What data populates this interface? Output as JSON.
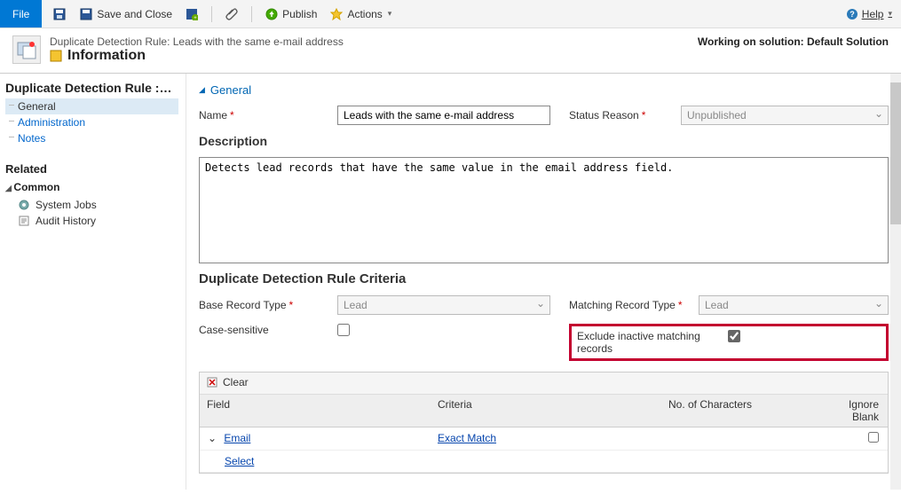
{
  "ribbon": {
    "file": "File",
    "save_close": "Save and Close",
    "publish": "Publish",
    "actions": "Actions",
    "help": "Help"
  },
  "header": {
    "entity": "Duplicate Detection Rule: Leads with the same e-mail address",
    "title": "Information",
    "solution_label": "Working on solution: Default Solution"
  },
  "sidebar": {
    "crumb": "Duplicate Detection Rule :…",
    "items": [
      {
        "label": "General"
      },
      {
        "label": "Administration"
      },
      {
        "label": "Notes"
      }
    ],
    "related": "Related",
    "common": "Common",
    "common_items": [
      {
        "label": "System Jobs"
      },
      {
        "label": "Audit History"
      }
    ]
  },
  "form": {
    "section": "General",
    "name_label": "Name",
    "name_value": "Leads with the same e-mail address",
    "status_label": "Status Reason",
    "status_value": "Unpublished",
    "description_label": "Description",
    "description_value": "Detects lead records that have the same value in the email address field.",
    "criteria_title": "Duplicate Detection Rule Criteria",
    "base_type_label": "Base Record Type",
    "base_type_value": "Lead",
    "case_sensitive_label": "Case-sensitive",
    "matching_type_label": "Matching Record Type",
    "matching_type_value": "Lead",
    "exclude_label": "Exclude inactive matching records"
  },
  "grid": {
    "clear": "Clear",
    "headers": {
      "field": "Field",
      "criteria": "Criteria",
      "chars": "No. of Characters",
      "ignore": "Ignore Blank"
    },
    "rows": [
      {
        "field": "Email",
        "criteria": "Exact Match",
        "chars": "",
        "ignore": false
      },
      {
        "field": "Select",
        "criteria": "",
        "chars": "",
        "ignore": null
      }
    ]
  }
}
